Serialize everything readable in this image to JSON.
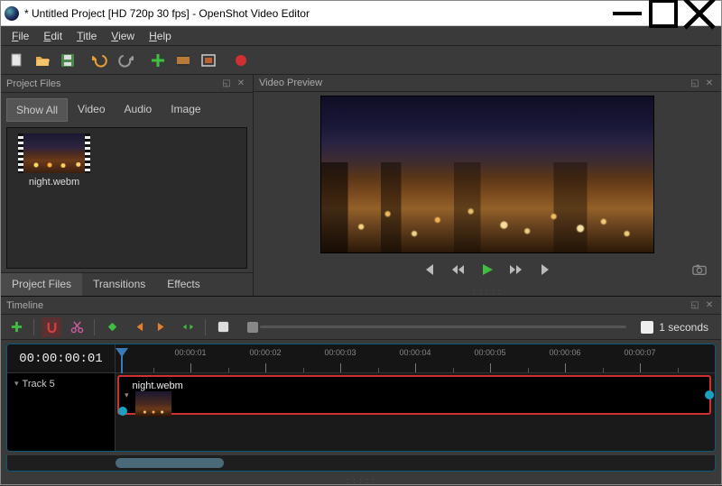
{
  "window": {
    "title": "* Untitled Project [HD 720p 30 fps] - OpenShot Video Editor"
  },
  "menu": {
    "file": "File",
    "edit": "Edit",
    "title": "Title",
    "view": "View",
    "help": "Help"
  },
  "panels": {
    "project_files": "Project Files",
    "video_preview": "Video Preview",
    "timeline": "Timeline"
  },
  "filters": {
    "show_all": "Show All",
    "video": "Video",
    "audio": "Audio",
    "image": "Image"
  },
  "clips": [
    {
      "name": "night.webm"
    }
  ],
  "bottom_tabs": {
    "project_files": "Project Files",
    "transitions": "Transitions",
    "effects": "Effects"
  },
  "timeline": {
    "timecode": "00:00:00:01",
    "zoom_label": "1 seconds",
    "ticks": [
      "00:00:01",
      "00:00:02",
      "00:00:03",
      "00:00:04",
      "00:00:05",
      "00:00:06",
      "00:00:07"
    ],
    "tracks": [
      {
        "name": "Track 5",
        "clip": "night.webm"
      }
    ]
  }
}
